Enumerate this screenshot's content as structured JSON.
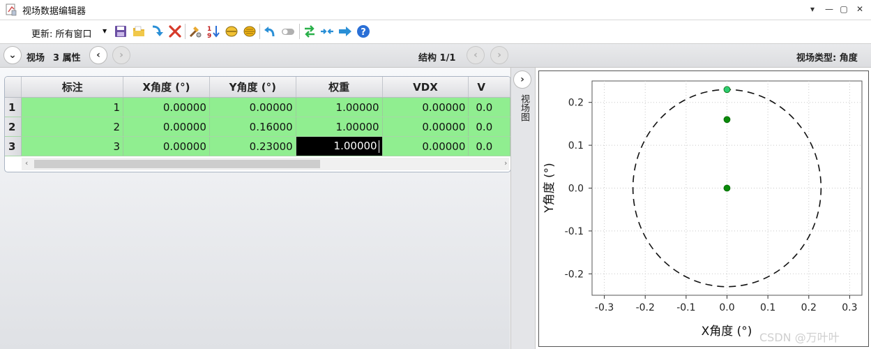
{
  "window": {
    "title": "视场数据编辑器",
    "controls": [
      "▾",
      "—",
      "▢",
      "✕"
    ]
  },
  "toolbar": {
    "update_label": "更新: 所有窗口",
    "icons": [
      "save-icon",
      "open-folder-icon",
      "import-icon",
      "delete-icon",
      "tools-icon",
      "sort-numeric-icon",
      "lens-icon",
      "lens-solid-icon",
      "undo-icon",
      "toggle-icon",
      "swap-icon",
      "merge-icon",
      "arrow-right-icon",
      "help-icon"
    ]
  },
  "nav": {
    "left_label": "视场",
    "count_label": "3 属性",
    "structure_label": "结构 1/1",
    "field_type_label": "视场类型: 角度"
  },
  "grid": {
    "columns": [
      "标注",
      "X角度 (°)",
      "Y角度 (°)",
      "权重",
      "VDX",
      "V"
    ],
    "rows": [
      {
        "row": "1",
        "cells": [
          "1",
          "0.00000",
          "0.00000",
          "1.00000",
          "0.00000",
          "0.0"
        ]
      },
      {
        "row": "2",
        "cells": [
          "2",
          "0.00000",
          "0.16000",
          "1.00000",
          "0.00000",
          "0.0"
        ]
      },
      {
        "row": "3",
        "cells": [
          "3",
          "0.00000",
          "0.23000",
          "1.00000",
          "0.00000",
          "0.0"
        ]
      }
    ],
    "selected": {
      "row": 2,
      "col": 3
    }
  },
  "side_tab": "视场图",
  "chart_data": {
    "type": "scatter",
    "xlabel": "X角度 (°)",
    "ylabel": "Y角度 (°)",
    "xlim": [
      -0.33,
      0.33
    ],
    "ylim": [
      -0.25,
      0.25
    ],
    "xticks": [
      -0.3,
      -0.2,
      -0.1,
      0.0,
      0.1,
      0.2,
      0.3
    ],
    "yticks": [
      -0.2,
      -0.1,
      0.0,
      0.1,
      0.2
    ],
    "xtick_labels": [
      "-0.3",
      "-0.2",
      "-0.1",
      "0.0",
      "0.1",
      "0.2",
      "0.3"
    ],
    "ytick_labels": [
      "-0.2",
      "-0.1",
      "0.0",
      "0.1",
      "0.2"
    ],
    "grid": true,
    "points": [
      {
        "x": 0.0,
        "y": 0.0,
        "color": "#0a8a0a"
      },
      {
        "x": 0.0,
        "y": 0.16,
        "color": "#0a8a0a"
      },
      {
        "x": 0.0,
        "y": 0.23,
        "color": "#2ecc71"
      }
    ],
    "circle_radius": 0.23,
    "colors": {
      "point": "#0a8a0a",
      "point_highlight": "#2ecc71",
      "row_fill": "#90ee90"
    }
  },
  "watermark": "CSDN @万叶叶"
}
